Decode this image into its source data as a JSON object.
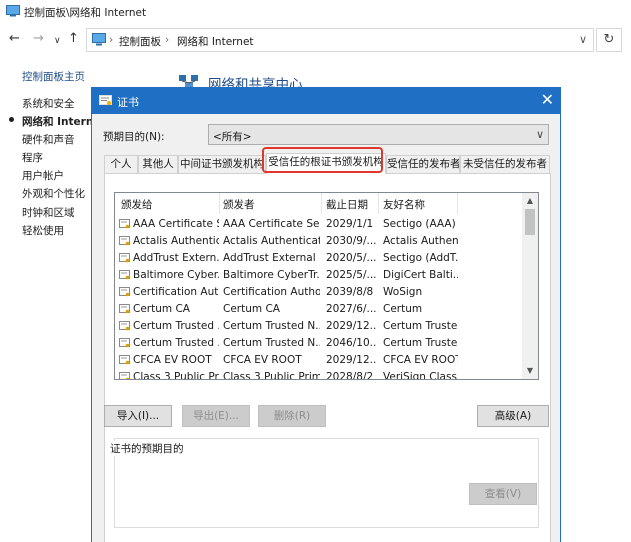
{
  "window": {
    "title": "控制面板\\网络和 Internet"
  },
  "nav": {
    "back": "←",
    "forward": "→",
    "recent": "∨",
    "up": "↑",
    "address": [
      "控制面板",
      "网络和 Internet"
    ],
    "separator": "›",
    "dropdown": "∨",
    "refresh": "↻"
  },
  "sidebar": {
    "home": "控制面板主页",
    "items": [
      "系统和安全",
      "网络和 Internet",
      "硬件和声音",
      "程序",
      "用户帐户",
      "外观和个性化",
      "时钟和区域",
      "轻松使用"
    ]
  },
  "main": {
    "heading": "网络和共享中心"
  },
  "dialog": {
    "title": "证书",
    "close": "✕",
    "purpose_label": "预期目的(N):",
    "purpose_value": "<所有>",
    "tabs": [
      "个人",
      "其他人",
      "中间证书颁发机构",
      "受信任的根证书颁发机构",
      "受信任的发布者",
      "未受信任的发布者"
    ],
    "selected_tab": "受信任的根证书颁发机构",
    "columns": [
      "颁发给",
      "颁发者",
      "截止日期",
      "友好名称"
    ],
    "rows": [
      [
        "AAA Certificate Ser...",
        "AAA Certificate Ser...",
        "2029/1/1",
        "Sectigo (AAA)"
      ],
      [
        "Actalis Authentic...",
        "Actalis Authenticati...",
        "2030/9/...",
        "Actalis Authen..."
      ],
      [
        "AddTrust Extern...",
        "AddTrust External ...",
        "2020/5/...",
        "Sectigo (AddT..."
      ],
      [
        "Baltimore Cyber...",
        "Baltimore CyberTr...",
        "2025/5/...",
        "DigiCert Balti..."
      ],
      [
        "Certification Aut...",
        "Certification Autho...",
        "2039/8/8",
        "WoSign"
      ],
      [
        "Certum CA",
        "Certum CA",
        "2027/6/...",
        "Certum"
      ],
      [
        "Certum Trusted ...",
        "Certum Trusted N...",
        "2029/12...",
        "Certum Truste..."
      ],
      [
        "Certum Trusted ...",
        "Certum Trusted N...",
        "2046/10...",
        "Certum Truste..."
      ],
      [
        "CFCA EV ROOT",
        "CFCA EV ROOT",
        "2029/12...",
        "CFCA EV ROOT"
      ],
      [
        "Class 3 Public Pr...",
        "Class 3 Public Prim...",
        "2028/8/2",
        "VeriSign Class..."
      ]
    ],
    "buttons": {
      "import": "导入(I)...",
      "export": "导出(E)...",
      "remove": "删除(R)",
      "advanced": "高级(A)",
      "view": "查看(V)"
    },
    "purposes_group": "证书的预期目的"
  },
  "colors": {
    "accent": "#1f6fc5",
    "highlight": "#e0362c",
    "link": "#1e4d8a"
  }
}
